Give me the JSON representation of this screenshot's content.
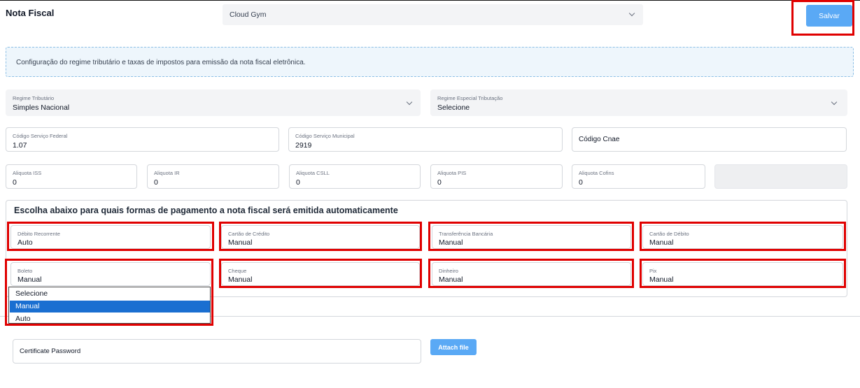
{
  "header": {
    "title": "Nota Fiscal",
    "company_select": "Cloud Gym",
    "save_label": "Salvar"
  },
  "info": {
    "text": "Configuração do regime tributário e taxas de impostos para emissão da nota fiscal eletrônica."
  },
  "tax": {
    "regime": {
      "label": "Regime Tributário",
      "value": "Simples Nacional"
    },
    "regime_especial": {
      "label": "Regime Especial Tributação",
      "value": "Selecione"
    },
    "codigo_federal": {
      "label": "Código Serviço Federal",
      "value": "1.07"
    },
    "codigo_municipal": {
      "label": "Código Serviço Municipal",
      "value": "2919"
    },
    "codigo_cnae": {
      "placeholder": "Código Cnae"
    },
    "aliquotas": [
      {
        "label": "Aliquota ISS",
        "value": "0"
      },
      {
        "label": "Aliquota IR",
        "value": "0"
      },
      {
        "label": "Aliquota CSLL",
        "value": "0"
      },
      {
        "label": "Aliquota PIS",
        "value": "0"
      },
      {
        "label": "Aliquota Cofins",
        "value": "0"
      }
    ]
  },
  "payments": {
    "title": "Escolha abaixo para quais formas de pagamento a nota fiscal será emitida automaticamente",
    "items": [
      {
        "label": "Débito Recorrente",
        "value": "Auto"
      },
      {
        "label": "Cartão de Crédito",
        "value": "Manual"
      },
      {
        "label": "Transferência Bancária",
        "value": "Manual"
      },
      {
        "label": "Cartão de Débito",
        "value": "Manual"
      },
      {
        "label": "Boleto",
        "value": "Manual"
      },
      {
        "label": "Cheque",
        "value": "Manual"
      },
      {
        "label": "Dinheiro",
        "value": "Manual"
      },
      {
        "label": "Pix",
        "value": "Manual"
      }
    ],
    "dropdown_options": [
      "Selecione",
      "Manual",
      "Auto"
    ],
    "dropdown_selected": "Manual"
  },
  "certificate": {
    "password_placeholder": "Certificate Password",
    "attach_label": "Attach file"
  },
  "colors": {
    "accent": "#5aa9f5",
    "highlight": "#e00000",
    "selected_option": "#1a6fd1"
  }
}
